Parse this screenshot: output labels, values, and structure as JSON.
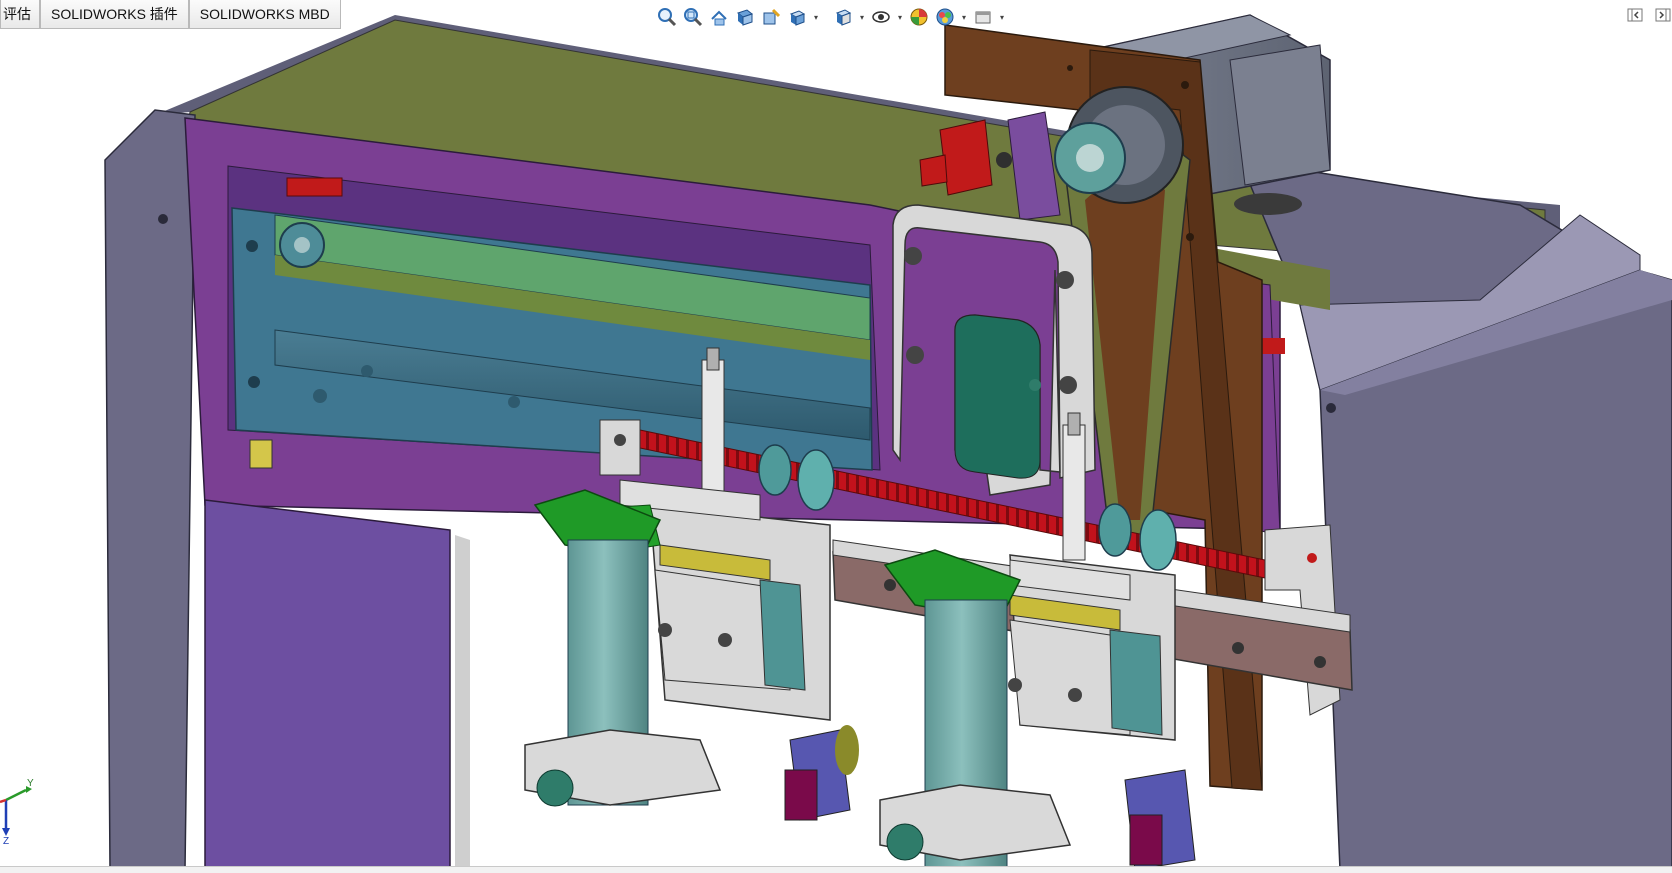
{
  "tabs": [
    {
      "label": "评估"
    },
    {
      "label": "SOLIDWORKS 插件"
    },
    {
      "label": "SOLIDWORKS MBD"
    }
  ],
  "heads_up_toolbar": {
    "icons": [
      "zoom-to-fit-icon",
      "zoom-area-icon",
      "previous-view-icon",
      "section-view-icon",
      "dynamic-annotation-icon",
      "view-orientation-icon",
      "display-style-icon",
      "hide-show-items-icon",
      "edit-appearance-icon",
      "apply-scene-icon",
      "view-settings-icon"
    ]
  },
  "triad": {
    "x_label": "Y",
    "z_label": "Z"
  },
  "colors": {
    "frame_side": "#6f6d89",
    "purple_panel": "#7b3f93",
    "olive_plate": "#6f7a3e",
    "brown_plate": "#6e3f1f",
    "screw_red": "#c0101a",
    "teal_cylinder": "#7fb2b0",
    "green_clamp": "#22a02a",
    "light_gray_part": "#d6d6d6"
  }
}
